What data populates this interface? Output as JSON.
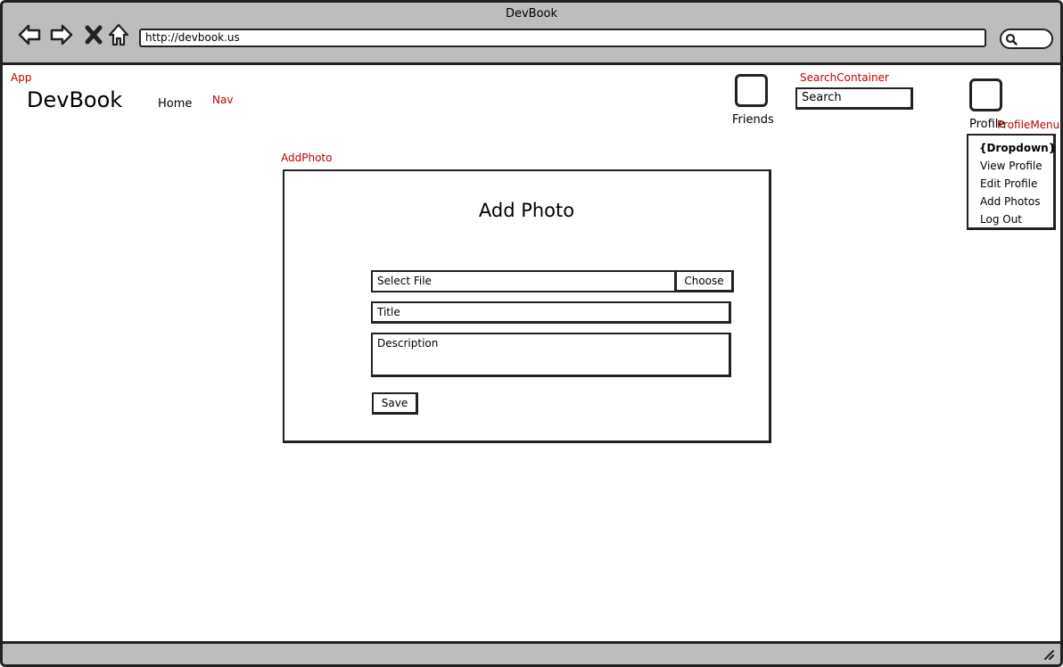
{
  "browser": {
    "window_title": "DevBook",
    "url": "http://devbook.us",
    "icons": [
      "back-arrow-icon",
      "forward-arrow-icon",
      "close-icon",
      "home-icon",
      "search-icon",
      "resize-grip-icon"
    ]
  },
  "annotations": {
    "app": "App",
    "nav": "Nav",
    "search_container": "SearchContainer",
    "profile_menu": "ProfileMenu",
    "add_photo": "AddPhoto"
  },
  "header": {
    "brand": "DevBook",
    "home_link": "Home",
    "friends_label": "Friends",
    "search_placeholder": "Search",
    "profile_label": "Profile"
  },
  "profile_menu": {
    "items": [
      "{Dropdown}",
      "View Profile",
      "Edit Profile",
      "Add Photos",
      "Log Out"
    ]
  },
  "add_photo": {
    "title": "Add Photo",
    "file_field": "Select File",
    "choose_button": "Choose",
    "title_field": "Title",
    "description_field": "Description",
    "save_button": "Save"
  },
  "colors": {
    "annotation": "#c00000",
    "chrome": "#bdbdbd",
    "stroke": "#222222"
  }
}
